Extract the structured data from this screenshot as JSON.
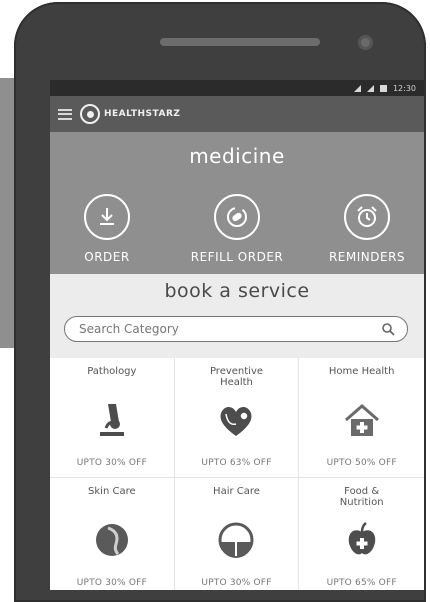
{
  "app": {
    "logo_text": "HEALTHSTARZ",
    "status": {
      "time": "12:30"
    }
  },
  "medicine": {
    "title": "medicine",
    "actions": [
      {
        "label": "ORDER",
        "icon": "download-icon"
      },
      {
        "label": "REFILL ORDER",
        "icon": "refill-icon"
      },
      {
        "label": "REMINDERS",
        "icon": "alarm-clock-icon"
      }
    ]
  },
  "services": {
    "title": "book a service",
    "search_placeholder": "Search Category",
    "items": [
      {
        "name": "Pathology",
        "offer": "UPTO 30% OFF",
        "icon": "microscope-icon"
      },
      {
        "name": "Preventive\nHealth",
        "offer": "UPTO 63% OFF",
        "icon": "heart-stethoscope-icon"
      },
      {
        "name": "Home Health",
        "offer": "UPTO 50% OFF",
        "icon": "home-health-icon"
      },
      {
        "name": "Skin Care",
        "offer": "UPTO 30% OFF",
        "icon": "skin-care-icon"
      },
      {
        "name": "Hair Care",
        "offer": "UPTO 30% OFF",
        "icon": "hair-care-icon"
      },
      {
        "name": "Food &\nNutrition",
        "offer": "UPTO 65% OFF",
        "icon": "apple-nutrition-icon"
      }
    ]
  },
  "colors": {
    "app_bar": "#5a5a5a",
    "medicine_panel": "#8f8f8f",
    "service_panel": "#ececec",
    "icon_dark": "#4d4d4d"
  }
}
